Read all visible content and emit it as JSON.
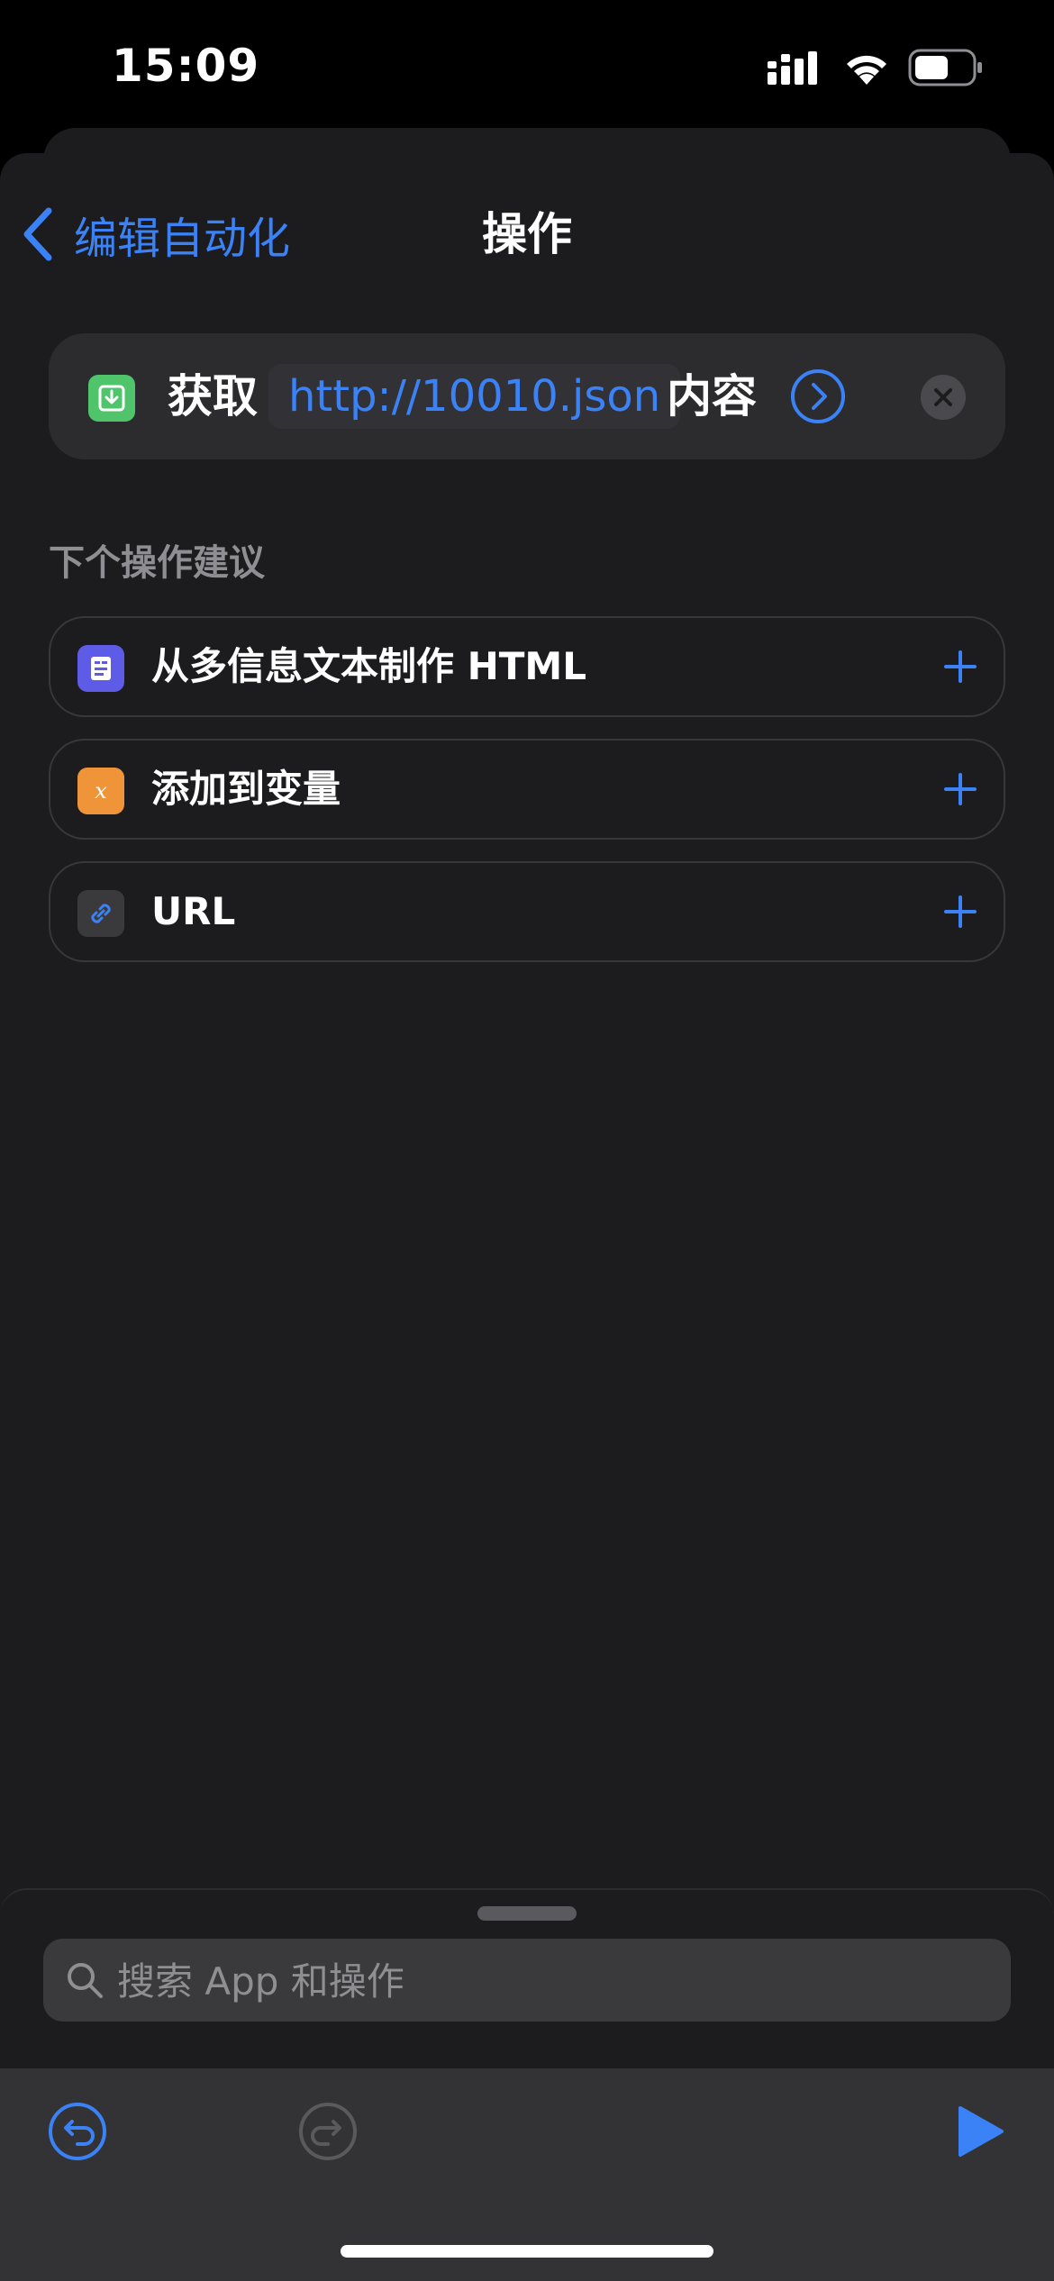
{
  "status_bar": {
    "time": "15:09"
  },
  "nav": {
    "back_label": "编辑自动化",
    "title": "操作"
  },
  "action": {
    "verb": "获取",
    "url": "http://10010.json",
    "noun": "内容",
    "icon": "download-icon",
    "icon_color": "#4fc46a"
  },
  "suggestions": {
    "header": "下个操作建议",
    "items": [
      {
        "label": "从多信息文本制作 HTML",
        "icon": "rich-text-icon",
        "color": "#5e5ce6"
      },
      {
        "label": "添加到变量",
        "icon": "variable-icon",
        "color": "#f0943a"
      },
      {
        "label": "URL",
        "icon": "link-icon",
        "color": "#3a3a3c"
      }
    ]
  },
  "search": {
    "placeholder": "搜索 App 和操作"
  },
  "colors": {
    "accent": "#3b82f6",
    "background": "#1c1c1e"
  }
}
